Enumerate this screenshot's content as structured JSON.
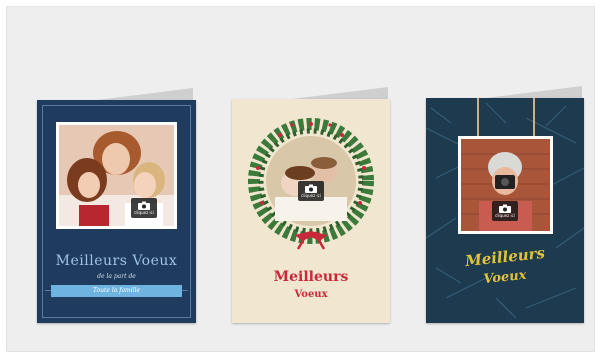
{
  "cards": [
    {
      "title": "Meilleurs Voeux",
      "subtitle": "de la part de",
      "ribbon": "Toute la famille",
      "upload_label": "cliquez ici",
      "accent": "#1f3b5d"
    },
    {
      "title_line1": "Meilleurs",
      "title_line2": "Voeux",
      "upload_label": "cliquez ici",
      "accent": "#c8283a"
    },
    {
      "title_line1": "Meilleurs",
      "title_line2": "Voeux",
      "upload_label": "cliquez ici",
      "accent": "#e2c23a"
    }
  ]
}
